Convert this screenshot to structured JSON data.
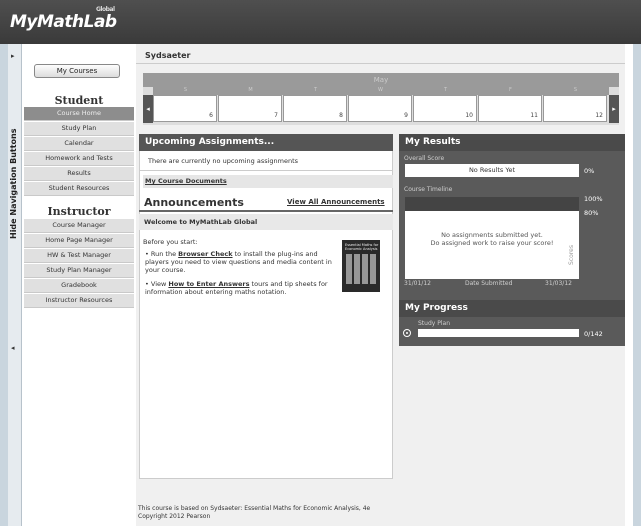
{
  "header": {
    "logo": "MyMathLab",
    "logo_small": "Global"
  },
  "hidebar": {
    "label": "Hide Navigation Buttons",
    "up_arrow": "▸",
    "down_arrow": "◂"
  },
  "nav": {
    "my_courses": "My Courses",
    "student_heading": "Student",
    "student_items": [
      "Course Home",
      "Study Plan",
      "Calendar",
      "Homework and Tests",
      "Results",
      "Student Resources"
    ],
    "instructor_heading": "Instructor",
    "instructor_items": [
      "Course Manager",
      "Home Page Manager",
      "HW & Test Manager",
      "Study Plan Manager",
      "Gradebook",
      "Instructor Resources"
    ]
  },
  "course_title": "Sydsaeter",
  "calendar": {
    "month": "May",
    "days": [
      "S",
      "M",
      "T",
      "W",
      "T",
      "F",
      "S"
    ],
    "dates": [
      "6",
      "7",
      "8",
      "9",
      "10",
      "11",
      "12"
    ],
    "prev": "◂",
    "next": "▸"
  },
  "upcoming": {
    "title": "Upcoming Assignments...",
    "empty": "There are currently no upcoming assignments",
    "documents_link": "My Course Documents"
  },
  "announcements": {
    "title": "Announcements",
    "view_all": "View All Announcements",
    "welcome": "Welcome to MyMathLab Global",
    "before": "Before you start:",
    "bullet1_pre": "Run the ",
    "bullet1_link": "Browser Check",
    "bullet1_post": " to install the plug-ins and players you need to view questions and media content in your course.",
    "bullet2_pre": "View ",
    "bullet2_link": "How to Enter Answers",
    "bullet2_post": " tours and tip sheets for information about entering maths notation.",
    "book_title": "Essential Maths for Economic Analysis"
  },
  "results": {
    "title": "My Results",
    "overall_label": "Overall Score",
    "overall_value": "No Results Yet",
    "overall_pct": "0%",
    "timeline_label": "Course Timeline",
    "pct_top": "100%",
    "pct_mid": "80%",
    "timeline_msg1": "No assignments submitted yet.",
    "timeline_msg2": "Do assigned work to raise your score!",
    "scores_label": "Scores",
    "axis_start": "31/01/12",
    "axis_mid": "Date Submitted",
    "axis_end": "31/03/12"
  },
  "progress": {
    "title": "My Progress",
    "study_plan_label": "Study Plan",
    "count": "0/142",
    "fraction": 0
  },
  "footer": {
    "line1": "This course is based on Sydsaeter: Essential Maths for Economic Analysis, 4e",
    "line2": "Copyright 2012 Pearson"
  }
}
